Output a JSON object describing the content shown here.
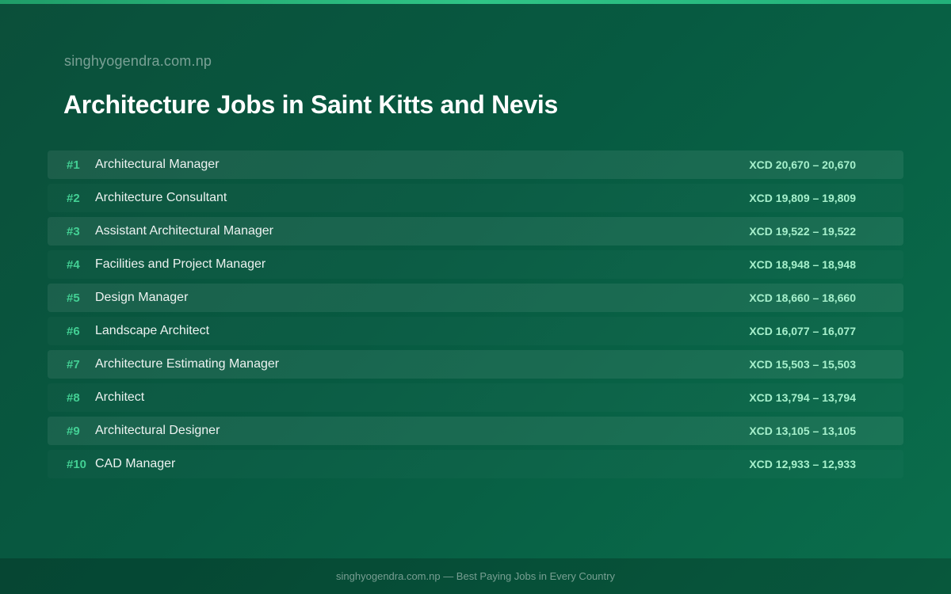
{
  "colors": {
    "background": "#075a41",
    "accent": "#2fc486",
    "rank": "#43d094",
    "salary": "#a6f0cc"
  },
  "header": {
    "site": "singhyogendra.com.np",
    "title": "Architecture Jobs in Saint Kitts and Nevis"
  },
  "jobs": [
    {
      "rank": "#1",
      "title": "Architectural Manager",
      "salary": "XCD 20,670 – 20,670"
    },
    {
      "rank": "#2",
      "title": "Architecture Consultant",
      "salary": "XCD 19,809 – 19,809"
    },
    {
      "rank": "#3",
      "title": "Assistant Architectural Manager",
      "salary": "XCD 19,522 – 19,522"
    },
    {
      "rank": "#4",
      "title": "Facilities and Project Manager",
      "salary": "XCD 18,948 – 18,948"
    },
    {
      "rank": "#5",
      "title": "Design Manager",
      "salary": "XCD 18,660 – 18,660"
    },
    {
      "rank": "#6",
      "title": "Landscape Architect",
      "salary": "XCD 16,077 – 16,077"
    },
    {
      "rank": "#7",
      "title": "Architecture Estimating Manager",
      "salary": "XCD 15,503 – 15,503"
    },
    {
      "rank": "#8",
      "title": "Architect",
      "salary": "XCD 13,794 – 13,794"
    },
    {
      "rank": "#9",
      "title": "Architectural Designer",
      "salary": "XCD 13,105 – 13,105"
    },
    {
      "rank": "#10",
      "title": "CAD Manager",
      "salary": "XCD 12,933 – 12,933"
    }
  ],
  "footer": {
    "text": "singhyogendra.com.np — Best Paying Jobs in Every Country"
  }
}
